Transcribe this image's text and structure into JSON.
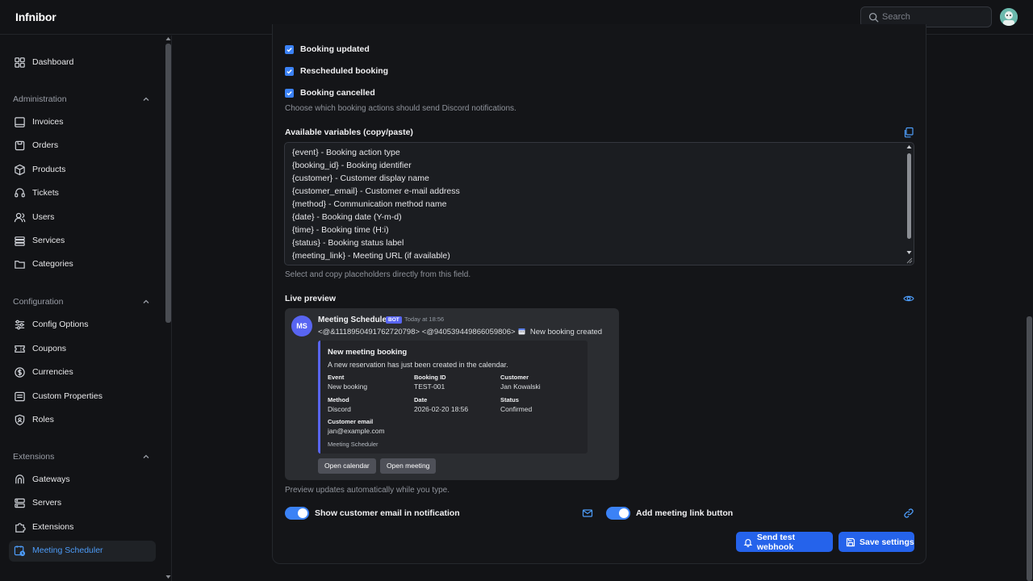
{
  "app": {
    "name": "Infnibor"
  },
  "search": {
    "placeholder": "Search"
  },
  "sidebar": {
    "top": [
      {
        "label": "Dashboard",
        "icon": "dashboard-icon"
      }
    ],
    "sections": [
      {
        "title": "Administration",
        "items": [
          {
            "label": "Invoices",
            "icon": "invoice-icon"
          },
          {
            "label": "Orders",
            "icon": "orders-icon"
          },
          {
            "label": "Products",
            "icon": "products-icon"
          },
          {
            "label": "Tickets",
            "icon": "tickets-icon"
          },
          {
            "label": "Users",
            "icon": "users-icon"
          },
          {
            "label": "Services",
            "icon": "services-icon"
          },
          {
            "label": "Categories",
            "icon": "categories-icon"
          }
        ]
      },
      {
        "title": "Configuration",
        "items": [
          {
            "label": "Config Options",
            "icon": "config-options-icon"
          },
          {
            "label": "Coupons",
            "icon": "coupons-icon"
          },
          {
            "label": "Currencies",
            "icon": "currencies-icon"
          },
          {
            "label": "Custom Properties",
            "icon": "custom-properties-icon"
          },
          {
            "label": "Roles",
            "icon": "roles-icon"
          }
        ]
      },
      {
        "title": "Extensions",
        "items": [
          {
            "label": "Gateways",
            "icon": "gateways-icon"
          },
          {
            "label": "Servers",
            "icon": "servers-icon"
          },
          {
            "label": "Extensions",
            "icon": "extensions-icon"
          },
          {
            "label": "Meeting Scheduler",
            "icon": "meeting-scheduler-icon",
            "active": true
          }
        ]
      }
    ]
  },
  "settings": {
    "checkboxes": [
      {
        "label": "Booking updated",
        "checked": true
      },
      {
        "label": "Rescheduled booking",
        "checked": true
      },
      {
        "label": "Booking cancelled",
        "checked": true
      }
    ],
    "actions_help": "Choose which booking actions should send Discord notifications.",
    "variables_label": "Available variables (copy/paste)",
    "variables": [
      "{event} - Booking action type",
      "{booking_id} - Booking identifier",
      "{customer} - Customer display name",
      "{customer_email} - Customer e-mail address",
      "{method} - Communication method name",
      "{date} - Booking date (Y-m-d)",
      "{time} - Booking time (H:i)",
      "{status} - Booking status label",
      "{meeting_link} - Meeting URL (if available)"
    ],
    "variables_help": "Select and copy placeholders directly from this field.",
    "preview_label": "Live preview",
    "preview_help": "Preview updates automatically while you type.",
    "toggles": [
      {
        "label": "Show customer email in notification",
        "on": true
      },
      {
        "label": "Add meeting link button",
        "on": true
      }
    ],
    "buttons": {
      "test": "Send test webhook",
      "save": "Save settings"
    }
  },
  "preview": {
    "avatar": "MS",
    "bot_name": "Meeting Scheduler",
    "bot_badge": "BOT",
    "time": "Today at 18:56",
    "mentions": "<@&1118950491762720798> <@940539449866059806>",
    "message": "New booking created",
    "embed": {
      "title": "New meeting booking",
      "description": "A new reservation has just been created in the calendar.",
      "fields": [
        {
          "name": "Event",
          "value": "New booking"
        },
        {
          "name": "Booking ID",
          "value": "TEST-001"
        },
        {
          "name": "Customer",
          "value": "Jan Kowalski"
        },
        {
          "name": "Method",
          "value": "Discord"
        },
        {
          "name": "Date",
          "value": "2026-02-20 18:56"
        },
        {
          "name": "Status",
          "value": "Confirmed"
        },
        {
          "name": "Customer email",
          "value": "jan@example.com"
        }
      ],
      "footer": "Meeting Scheduler",
      "color": "#5865f2"
    },
    "buttons": [
      "Open calendar",
      "Open meeting"
    ]
  },
  "colors": {
    "accent": "#3b82f6",
    "button": "#2563eb",
    "discord_blurple": "#5865f2"
  }
}
